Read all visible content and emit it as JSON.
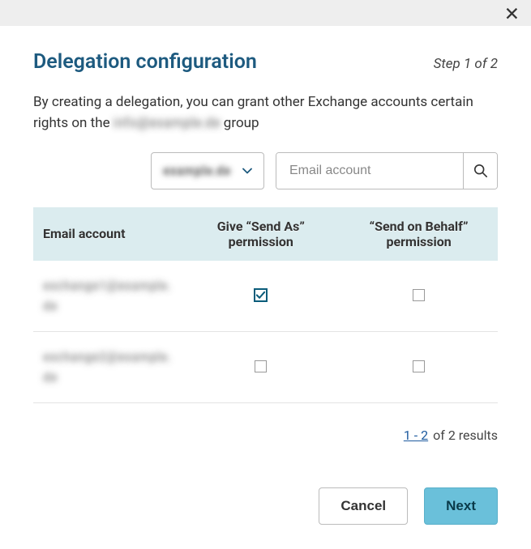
{
  "title": "Delegation configuration",
  "step": "Step 1 of 2",
  "description_before": "By creating a delegation, you can grant other Exchange accounts certain rights on the ",
  "description_group": "info@example.de",
  "description_after": " group",
  "dropdown": {
    "selected": "example.de"
  },
  "search": {
    "placeholder": "Email account"
  },
  "table": {
    "headers": {
      "email": "Email account",
      "send_as": "Give “Send As” permission",
      "send_on_behalf": "“Send on Behalf” permission"
    },
    "rows": [
      {
        "email": "exchange1@example.de",
        "send_as": true,
        "send_on_behalf": false
      },
      {
        "email": "exchange2@example.de",
        "send_as": false,
        "send_on_behalf": false
      }
    ]
  },
  "pagination": {
    "range": "1 - 2",
    "suffix": " of 2 results"
  },
  "buttons": {
    "cancel": "Cancel",
    "next": "Next"
  }
}
